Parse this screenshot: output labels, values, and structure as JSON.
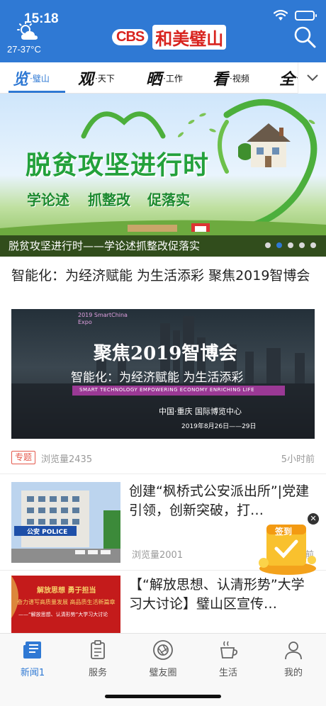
{
  "status_bar": {
    "time": "15:18",
    "temperature": "27-37°C",
    "weather_icon": "sun-cloud-icon"
  },
  "header": {
    "logo_cbs": "CBS",
    "logo_text": "和美璧山",
    "search_icon": "search-icon"
  },
  "tabs": [
    {
      "big": "览",
      "small": "·璧山",
      "active": true
    },
    {
      "big": "观",
      "small": "·天下",
      "active": false
    },
    {
      "big": "晒",
      "small": "·工作",
      "active": false
    },
    {
      "big": "看",
      "small": "·视频",
      "active": false
    },
    {
      "big": "全",
      "small": "·",
      "active": false
    }
  ],
  "banner": {
    "headline": "脱贫攻坚进行时",
    "slogans": [
      "学论述",
      "抓整改",
      "促落实"
    ],
    "caption": "脱贫攻坚进行时——学论述抓整改促落实",
    "slide_count": 5,
    "active_slide": 1
  },
  "featured": {
    "title": "智能化：为经济赋能 为生活添彩 聚焦2019智博会",
    "image": {
      "logo_text": "2019 SmartChina Expo",
      "headline": "聚焦2019智博会",
      "subtitle": "智能化：为经济赋能 为生活添彩",
      "english": "SMART TECHNOLOGY EMPOWERING ECONOMY ENRICHING LIFE",
      "venue": "中国·重庆 国际博览中心",
      "dates": "2019年8月26日——29日"
    },
    "tag": "专题",
    "views": "浏览量2435",
    "time_ago": "5小时前"
  },
  "list": [
    {
      "title": "创建“枫桥式公安派出所”|党建引领，创新突破，打…",
      "views": "浏览量2001",
      "thumb_text": "公安 POLICE",
      "time_ago": "前"
    },
    {
      "title": "【“解放思想、认清形势”大学习大讨论】璧山区宣传…",
      "views": "",
      "thumb_lines": [
        "解放思想 勇于担当",
        "奋力谱写高质量发展 高品质生活新篇章",
        "——“解放思想、认清形势”大学习大讨论"
      ]
    }
  ],
  "floating": {
    "signin_label": "签到"
  },
  "bottom_nav": [
    {
      "label": "新闻1",
      "icon": "news-icon",
      "active": true
    },
    {
      "label": "服务",
      "icon": "clipboard-icon",
      "active": false
    },
    {
      "label": "璧友圈",
      "icon": "camera-shutter-icon",
      "active": false
    },
    {
      "label": "生活",
      "icon": "coffee-cup-icon",
      "active": false
    },
    {
      "label": "我的",
      "icon": "person-icon",
      "active": false
    }
  ],
  "colors": {
    "brand_blue": "#2f79d4",
    "brand_red": "#d8231e",
    "tag_red": "#e4584c"
  }
}
